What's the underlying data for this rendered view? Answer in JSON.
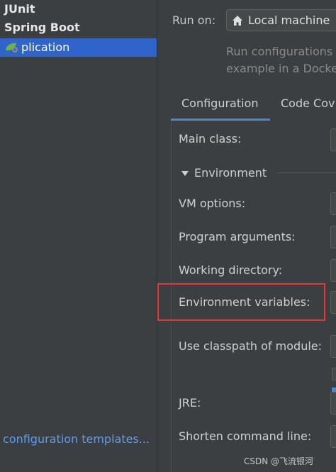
{
  "sidebar": {
    "tree": {
      "junit": "JUnit",
      "spring_boot": "Spring Boot",
      "selected_item": "        plication"
    },
    "config_templates_link": "configuration templates..."
  },
  "run_on": {
    "label": "Run on:",
    "value": "Local machine",
    "description_line1": "Run configurations",
    "description_line2": "example in a Docke"
  },
  "tabs": [
    {
      "label": "Configuration",
      "active": true
    },
    {
      "label": "Code Cov",
      "active": false
    }
  ],
  "fields": {
    "main_class": "Main class:",
    "environment_section": "Environment",
    "vm_options": "VM options:",
    "program_arguments": "Program arguments:",
    "working_directory": "Working directory:",
    "environment_variables": "Environment variables:",
    "classpath_module": "Use classpath of module:",
    "jre": "JRE:",
    "shorten_command_line": "Shorten command line:"
  },
  "watermark": "CSDN @飞流银河",
  "colors": {
    "background": "#3c3f41",
    "selection": "#2f65ca",
    "link": "#589df6",
    "accent": "#4a88c7",
    "highlight": "#e53935"
  },
  "icons": {
    "spring": "spring-boot-icon",
    "home": "home-icon",
    "triangle": "triangle-down-icon"
  }
}
